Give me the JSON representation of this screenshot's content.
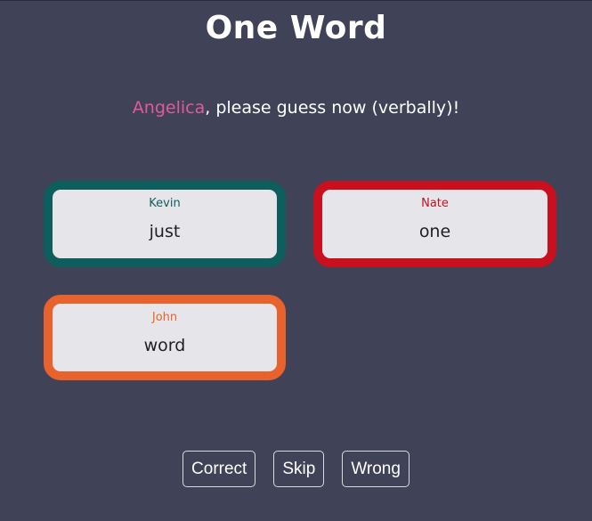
{
  "title": "One Word",
  "prompt": {
    "guesser": "Angelica",
    "guesser_color": "#e05a9e",
    "message": ", please guess now (verbally)!"
  },
  "cards": [
    {
      "player": "Kevin",
      "word": "just",
      "color": "#0f5e5e"
    },
    {
      "player": "Nate",
      "word": "one",
      "color": "#c8101e"
    },
    {
      "player": "John",
      "word": "word",
      "color": "#e8622e"
    }
  ],
  "buttons": {
    "correct": "Correct",
    "skip": "Skip",
    "wrong": "Wrong"
  }
}
